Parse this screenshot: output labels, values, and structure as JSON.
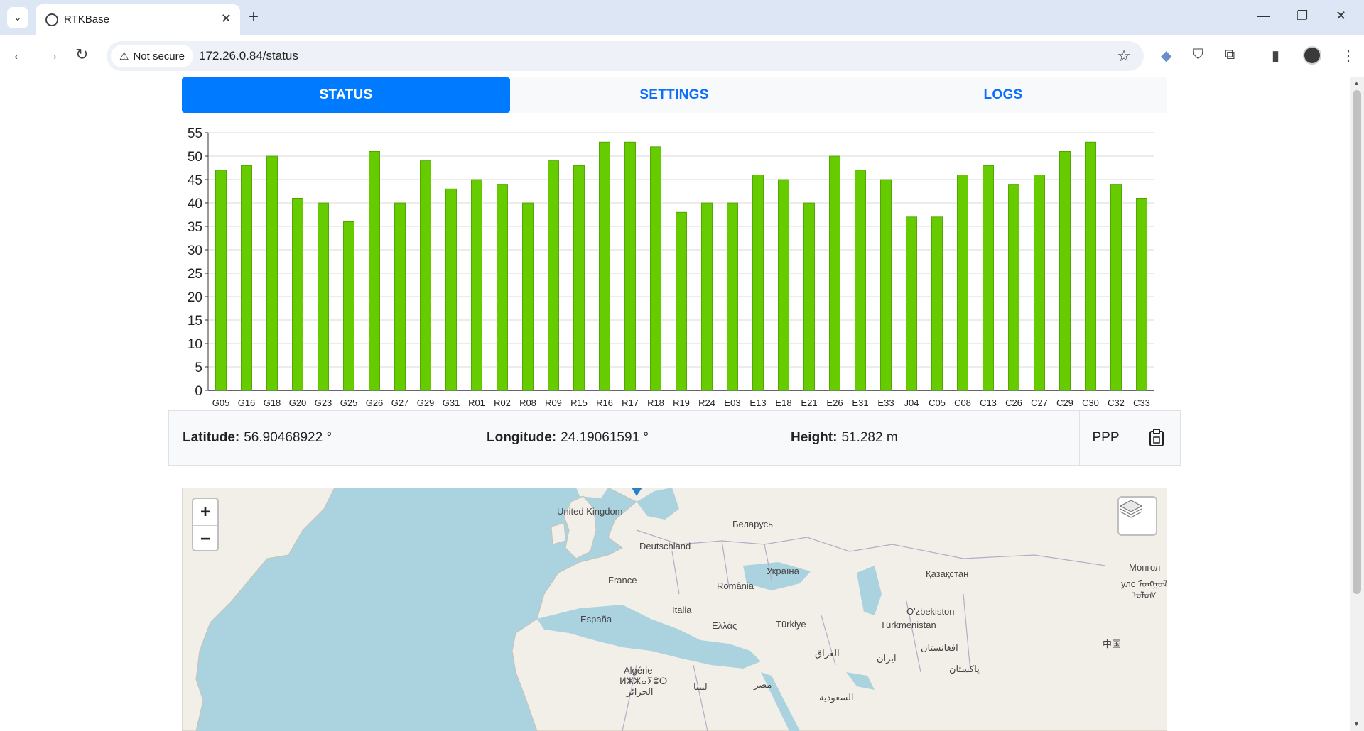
{
  "browser": {
    "tab_title": "RTKBase",
    "url": "172.26.0.84/status",
    "security_label": "Not secure"
  },
  "nav": {
    "tabs": [
      {
        "label": "STATUS",
        "active": true
      },
      {
        "label": "SETTINGS",
        "active": false
      },
      {
        "label": "LOGS",
        "active": false
      }
    ]
  },
  "chart_data": {
    "type": "bar",
    "categories": [
      "G05",
      "G16",
      "G18",
      "G20",
      "G23",
      "G25",
      "G26",
      "G27",
      "G29",
      "G31",
      "R01",
      "R02",
      "R08",
      "R09",
      "R15",
      "R16",
      "R17",
      "R18",
      "R19",
      "R24",
      "E03",
      "E13",
      "E18",
      "E21",
      "E26",
      "E31",
      "E33",
      "J04",
      "C05",
      "C08",
      "C13",
      "C26",
      "C27",
      "C29",
      "C30",
      "C32",
      "C33"
    ],
    "values": [
      47,
      48,
      50,
      41,
      40,
      36,
      51,
      40,
      49,
      43,
      45,
      44,
      40,
      49,
      48,
      53,
      53,
      52,
      38,
      40,
      40,
      46,
      45,
      40,
      50,
      47,
      45,
      37,
      37,
      46,
      48,
      44,
      46,
      51,
      53,
      44,
      41
    ],
    "ylim": [
      0,
      55
    ],
    "yticks": [
      0,
      5,
      10,
      15,
      20,
      25,
      30,
      35,
      40,
      45,
      50,
      55
    ],
    "bar_color": "#66cc00",
    "grid": true
  },
  "position": {
    "latitude_label": "Latitude:",
    "latitude_value": "56.90468922 °",
    "longitude_label": "Longitude:",
    "longitude_value": "24.19061591 °",
    "height_label": "Height:",
    "height_value": "51.282 m",
    "mode": "PPP"
  },
  "map": {
    "zoom_in": "+",
    "zoom_out": "−",
    "labels": [
      {
        "text": "United Kingdom"
      },
      {
        "text": "Беларусь"
      },
      {
        "text": "Deutschland"
      },
      {
        "text": "Україна"
      },
      {
        "text": "Қазақстан"
      },
      {
        "text": "Монгол"
      },
      {
        "text": "улс ᠮᠣᠩᠭᠣᠯ"
      },
      {
        "text": "ᠤᠯᠤᠰ"
      },
      {
        "text": "France"
      },
      {
        "text": "România"
      },
      {
        "text": "O'zbekiston"
      },
      {
        "text": "Italia"
      },
      {
        "text": "España"
      },
      {
        "text": "Türkiye"
      },
      {
        "text": "Türkmenistan"
      },
      {
        "text": "Ελλάς"
      },
      {
        "text": "中国"
      },
      {
        "text": "العراق"
      },
      {
        "text": "ایران"
      },
      {
        "text": "افغانستان"
      },
      {
        "text": "Algérie"
      },
      {
        "text": "ⵍⵣⵣⴰⵢⴻⵔ"
      },
      {
        "text": "الجزائر"
      },
      {
        "text": "پاکستان"
      },
      {
        "text": "ليبيا"
      },
      {
        "text": "مصر"
      },
      {
        "text": "السعودية"
      }
    ]
  }
}
